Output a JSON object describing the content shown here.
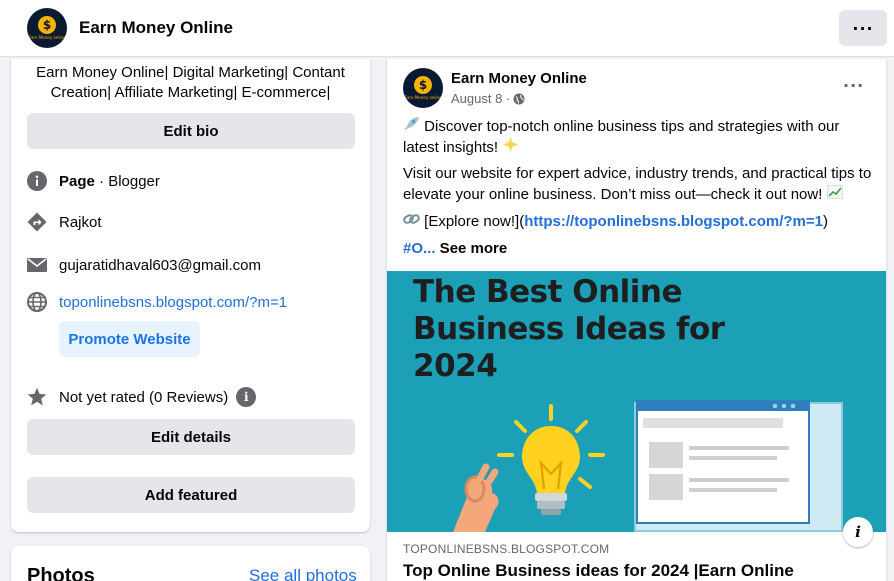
{
  "header": {
    "page_name": "Earn Money Online",
    "logo_tag": "Earn Money online"
  },
  "intro": {
    "bio": "Earn Money Online| Digital Marketing| Contant Creation| Affiliate Marketing| E-commerce|",
    "edit_bio_label": "Edit bio",
    "page_type_bold": "Page",
    "page_type_rest": " · Blogger",
    "location": "Rajkot",
    "email": "gujaratidhaval603@gmail.com",
    "website": "toponlinebsns.blogspot.com/?m=1",
    "promote_label": "Promote Website",
    "rating": "Not yet rated (0 Reviews)",
    "edit_details_label": "Edit details",
    "add_featured_label": "Add featured"
  },
  "photos": {
    "title": "Photos",
    "see_all": "See all photos"
  },
  "post": {
    "author": "Earn Money Online",
    "date": "August 8 ·",
    "line1": " Discover top-notch online business tips and strategies with our latest insights! ",
    "line2": " Visit our website for expert advice, industry trends, and practical tips to elevate your online business. Don’t miss out—check it out now! ",
    "line3_prefix": " [Explore now!](",
    "line3_link": "https://toponlinebsns.blogspot.com/?m=1",
    "line3_suffix": ")",
    "hashtag": "#O...",
    "see_more": " See more",
    "image_headline": "The Best Online Business Ideas for 2024",
    "link_domain": "TOPONLINEBSNS.BLOGSPOT.COM",
    "link_title": "Top Online Business ideas for 2024 |Earn Online"
  },
  "colors": {
    "brand_blue": "#216fdb",
    "image_bg": "#1ba0b8",
    "logo_bg": "#0b1a33",
    "logo_gold": "#f5b400"
  },
  "icons": [
    "info-icon",
    "directions-icon",
    "mail-icon",
    "globe-icon",
    "star-icon",
    "public-globe-icon",
    "more-horizontal-icon"
  ]
}
